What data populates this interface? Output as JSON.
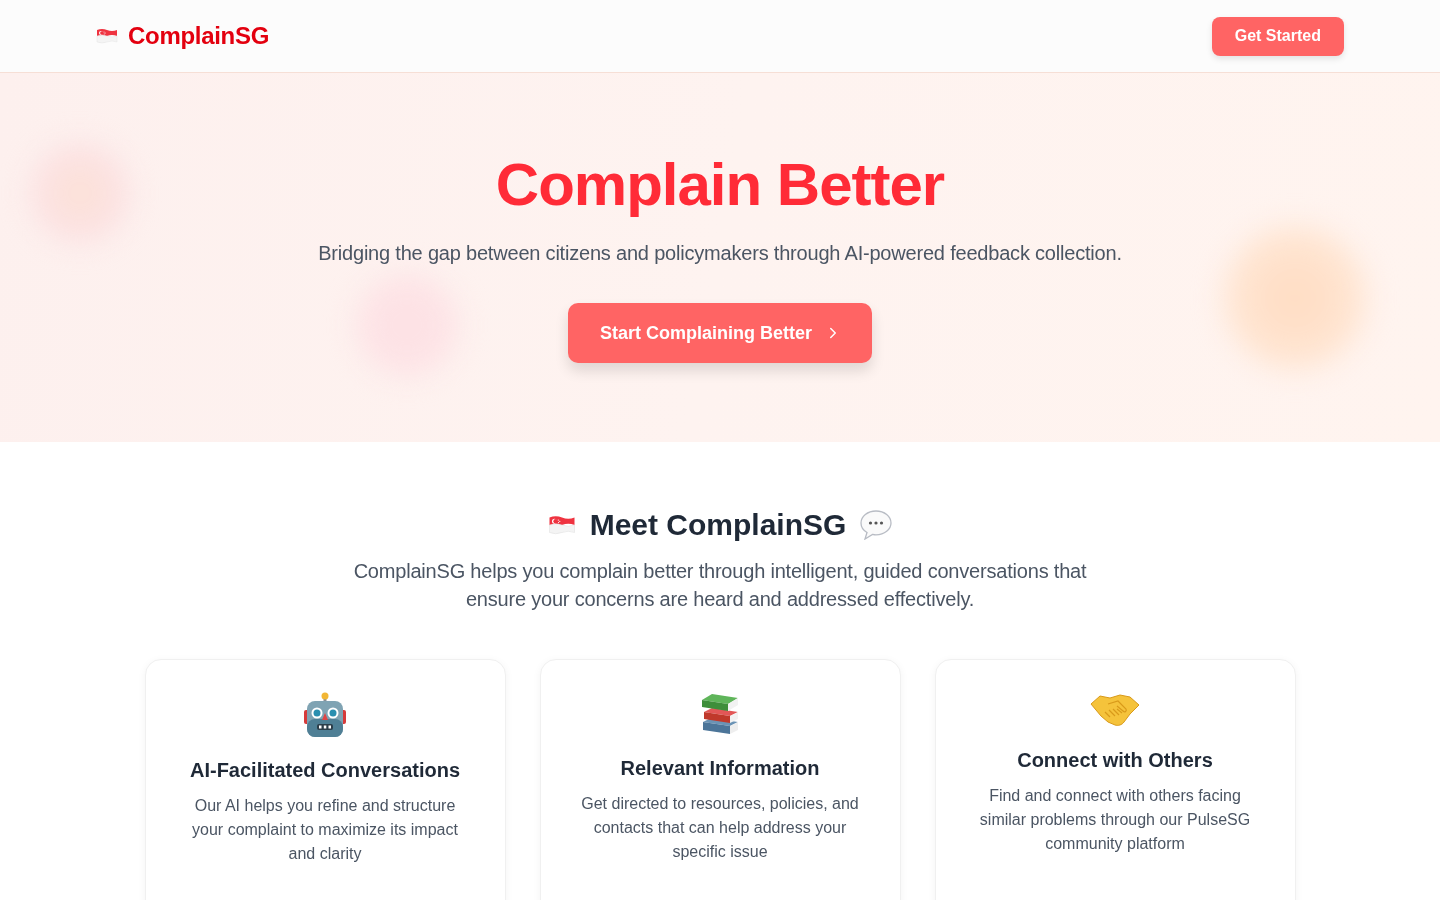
{
  "nav": {
    "logo": "ComplainSG",
    "cta": "Get Started"
  },
  "hero": {
    "title": "Complain Better",
    "subtitle": "Bridging the gap between citizens and policymakers through AI-powered feedback collection.",
    "button": "Start Complaining Better"
  },
  "intro": {
    "heading": "Meet ComplainSG",
    "text": "ComplainSG helps you complain better through intelligent, guided conversations that ensure your concerns are heard and addressed effectively."
  },
  "features": [
    {
      "kind": "robot",
      "title": "AI-Facilitated Conversations",
      "text": "Our AI helps you refine and structure your complaint to maximize its impact and clarity"
    },
    {
      "kind": "books",
      "title": "Relevant Information",
      "text": "Get directed to resources, policies, and contacts that can help address your specific issue"
    },
    {
      "kind": "handshake",
      "title": "Connect with Others",
      "text": "Find and connect with others facing similar problems through our PulseSG community platform"
    }
  ]
}
